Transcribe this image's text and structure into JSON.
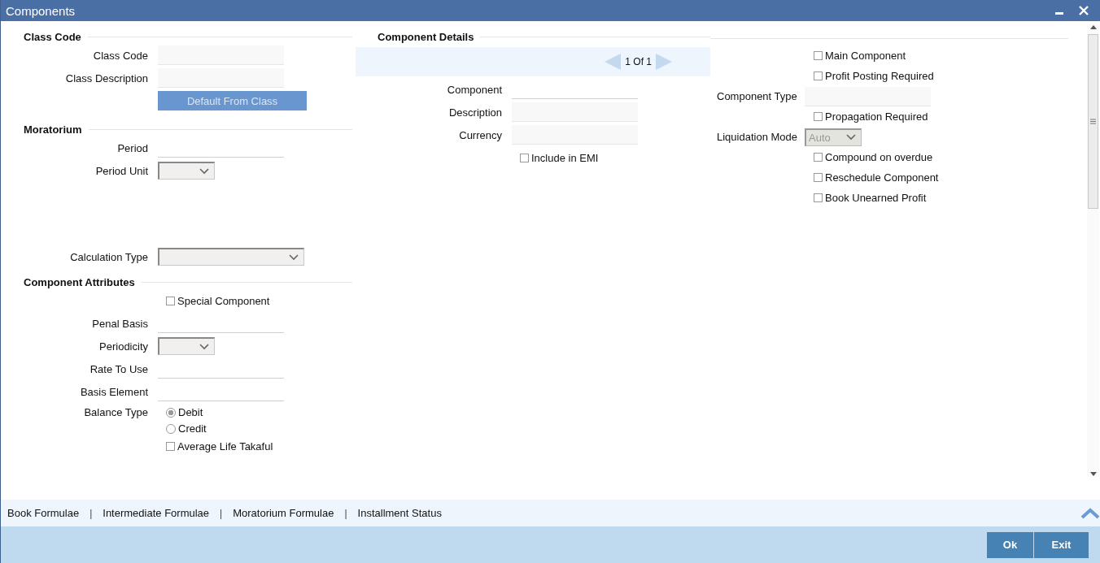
{
  "window": {
    "title": "Components"
  },
  "columns": [
    {
      "groups": [
        {
          "title": "Class Code",
          "rows": [
            {
              "kind": "box",
              "label": "Class Code"
            },
            {
              "kind": "box",
              "label": "Class Description"
            },
            {
              "kind": "button",
              "label": "Default From Class",
              "disabled": true
            }
          ]
        },
        {
          "title": "Moratorium",
          "rows": [
            {
              "kind": "line",
              "label": "Period"
            },
            {
              "kind": "select",
              "label": "Period Unit"
            }
          ]
        },
        {
          "rows": [
            {
              "kind": "combo",
              "label": "Calculation Type"
            }
          ]
        },
        {
          "title": "Component Attributes",
          "rows": [
            {
              "kind": "checkbox",
              "label": "Special Component",
              "checked": false
            },
            {
              "kind": "line",
              "label": "Penal Basis"
            },
            {
              "kind": "select",
              "label": "Periodicity"
            },
            {
              "kind": "line",
              "label": "Rate To Use"
            },
            {
              "kind": "line",
              "label": "Basis Element"
            },
            {
              "kind": "radio",
              "label": "Balance Type",
              "options": [
                {
                  "label": "Debit",
                  "selected": true
                },
                {
                  "label": "Credit",
                  "selected": false
                }
              ]
            },
            {
              "kind": "checkbox",
              "label": "Average Life Takaful",
              "checked": false
            }
          ]
        }
      ]
    },
    {
      "groups": [
        {
          "title": "Component Details",
          "rows": [
            {
              "kind": "pager",
              "text": "1 Of 1"
            },
            {
              "kind": "line",
              "label": "Component"
            },
            {
              "kind": "box",
              "label": "Description"
            },
            {
              "kind": "box",
              "label": "Currency"
            },
            {
              "kind": "checkbox",
              "label": "Include in EMI",
              "checked": false
            }
          ]
        }
      ]
    },
    {
      "groups": [
        {
          "rows": [
            {
              "kind": "checkbox",
              "label": "Main Component",
              "checked": false
            },
            {
              "kind": "checkbox",
              "label": "Profit Posting Required",
              "checked": false
            },
            {
              "kind": "box",
              "label": "Component Type"
            },
            {
              "kind": "checkbox",
              "label": "Propagation Required",
              "checked": false
            },
            {
              "kind": "select",
              "label": "Liquidation Mode",
              "value": "Auto",
              "disabled": true
            },
            {
              "kind": "checkbox",
              "label": "Compound on overdue",
              "checked": false
            },
            {
              "kind": "checkbox",
              "label": "Reschedule Component",
              "checked": false
            },
            {
              "kind": "checkbox",
              "label": "Book Unearned Profit",
              "checked": false
            }
          ]
        }
      ]
    }
  ],
  "footer_links": [
    {
      "kind": "link",
      "text": "Book Formulae"
    },
    {
      "kind": "separator",
      "text": "|"
    },
    {
      "kind": "link",
      "text": "Intermediate Formulae"
    },
    {
      "kind": "separator",
      "text": "|"
    },
    {
      "kind": "link",
      "text": "Moratorium Formulae"
    },
    {
      "kind": "separator",
      "text": "|"
    },
    {
      "kind": "link",
      "text": "Installment Status"
    }
  ],
  "buttons": [
    "Ok",
    "Exit"
  ]
}
